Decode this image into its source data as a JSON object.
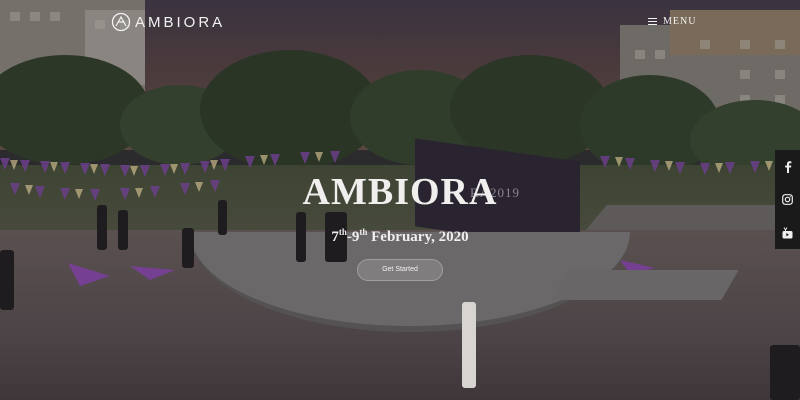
{
  "header": {
    "brand": "AMBIORA",
    "menu_label": "MENU"
  },
  "hero": {
    "title": "AMBIORA",
    "date_day_start": "7",
    "date_day_start_suffix": "th",
    "date_separator": "-",
    "date_day_end": "9",
    "date_day_end_suffix": "th",
    "date_rest": "February, 2020",
    "cta_label": "Get Started"
  },
  "scene": {
    "banner_text": "RA2019"
  },
  "social": {
    "items": [
      {
        "name": "facebook",
        "icon": "facebook-icon"
      },
      {
        "name": "instagram",
        "icon": "instagram-icon"
      },
      {
        "name": "youtube",
        "icon": "youtube-icon"
      }
    ]
  },
  "colors": {
    "overlay_text": "#f1efee",
    "social_bar_bg": "#1a1a1a"
  }
}
